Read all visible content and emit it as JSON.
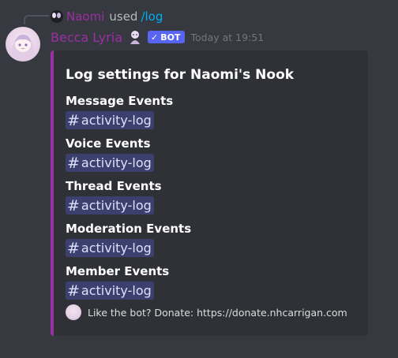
{
  "reply": {
    "username": "Naomi",
    "used_text": "used",
    "command": "/log"
  },
  "message": {
    "username": "Becca Lyria",
    "bot_tag": "BOT",
    "timestamp": "Today at 19:51"
  },
  "embed": {
    "accent_color": "#9c2fa4",
    "title": "Log settings for Naomi's Nook",
    "fields": [
      {
        "name": "Message Events",
        "channel": "activity-log"
      },
      {
        "name": "Voice Events",
        "channel": "activity-log"
      },
      {
        "name": "Thread Events",
        "channel": "activity-log"
      },
      {
        "name": "Moderation Events",
        "channel": "activity-log"
      },
      {
        "name": "Member Events",
        "channel": "activity-log"
      }
    ],
    "footer": "Like the bot? Donate: https://donate.nhcarrigan.com"
  },
  "icons": {
    "bot_verified": "check-icon",
    "channel": "hash-icon"
  }
}
